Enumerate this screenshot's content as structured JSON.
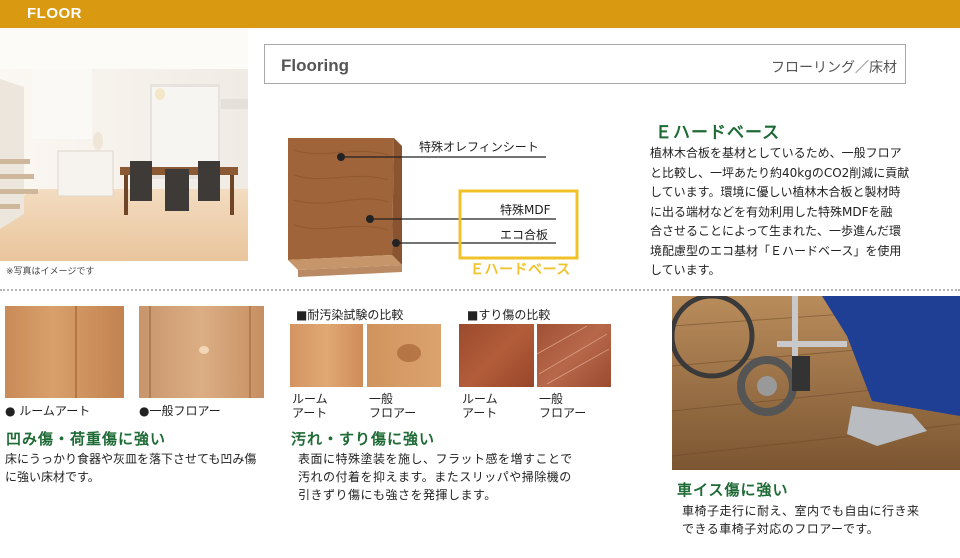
{
  "header": {
    "label": "FLOOR"
  },
  "room_note": "※写真はイメージです",
  "title_box": {
    "en": "Flooring",
    "ja": "フローリング／床材"
  },
  "diagram": {
    "label_sheet": "特殊オレフィンシート",
    "label_mdf": "特殊MDF",
    "label_plywood": "エコ合板",
    "label_ehb": "Ｅハードベース"
  },
  "ehard": {
    "title": "Ｅハードベース",
    "lines": [
      "植林木合板を基材としているため、一般フロア",
      "と比較し、一坪あたり約40kgのCO2削減に貢献",
      "しています。環境に優しい植林木合板と製材時",
      "に出る端材などを有効利用した特殊MDFを融",
      "合させることによって生まれた、一歩進んだ環",
      "境配慮型のエコ基材「Ｅハードベース」を使用",
      "しています。"
    ]
  },
  "dent": {
    "cap_room": "● ルームアート",
    "cap_general": "●一般フロアー",
    "title": "凹み傷・荷重傷に強い",
    "lines": [
      "床にうっかり食器や灰皿を落下させても凹み傷",
      "に強い床材です。"
    ]
  },
  "stain": {
    "compare_stain": "■耐汚染試験の比較",
    "compare_scratch": "■すり傷の比較",
    "room_art": "ルーム\nアート",
    "general": "一般\nフロアー",
    "title": "汚れ・すり傷に強い",
    "lines": [
      "表面に特殊塗装を施し、フラット感を増すことで",
      "汚れの付着を抑えます。またスリッパや掃除機の",
      "引きずり傷にも強さを発揮します。"
    ]
  },
  "wheelchair": {
    "title": "車イス傷に強い",
    "lines": [
      "車椅子走行に耐え、室内でも自由に行き来",
      "できる車椅子対応のフロアーです。"
    ]
  },
  "colors": {
    "header": "#d99a12",
    "green": "#1f6b36",
    "yellow": "#f0c22a"
  }
}
